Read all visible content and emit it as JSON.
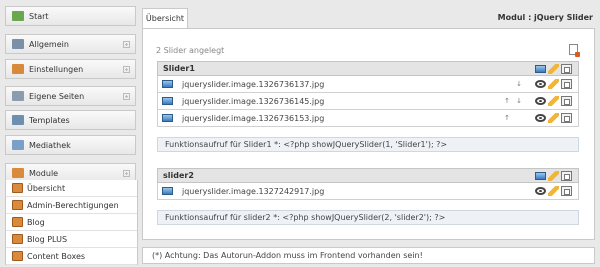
{
  "sidebar": {
    "items": [
      {
        "label": "Start",
        "icon": "home-icon",
        "color": "#6aa84f"
      },
      {
        "label": "Allgemein",
        "icon": "list-icon",
        "color": "#7b8fa6"
      },
      {
        "label": "Einstellungen",
        "icon": "settings-icon",
        "color": "#d88a3c"
      },
      {
        "label": "Eigene Seiten",
        "icon": "pages-icon",
        "color": "#8b9cae"
      },
      {
        "label": "Templates",
        "icon": "template-icon",
        "color": "#6f8fb0"
      },
      {
        "label": "Mediathek",
        "icon": "media-icon",
        "color": "#7aa0c8"
      },
      {
        "label": "Module",
        "icon": "module-icon",
        "color": "#d98a3c"
      }
    ],
    "sub_items": [
      {
        "label": "Übersicht"
      },
      {
        "label": "Admin-Berechtigungen"
      },
      {
        "label": "Blog"
      },
      {
        "label": "Blog PLUS"
      },
      {
        "label": "Content Boxes"
      }
    ]
  },
  "main": {
    "tab_label": "Übersicht",
    "module_title": "Modul : jQuery Slider",
    "slider_count_text": "2 Slider angelegt",
    "sliders": [
      {
        "title": "Slider1",
        "images": [
          {
            "filename": "jqueryslider.image.1326736137.jpg",
            "up": "",
            "down": "↓"
          },
          {
            "filename": "jqueryslider.image.1326736145.jpg",
            "up": "↑",
            "down": "↓"
          },
          {
            "filename": "jqueryslider.image.1326736153.jpg",
            "up": "↑",
            "down": ""
          }
        ],
        "function_call": "Funktionsaufruf für Slider1 *: <?php showJQuerySlider(1, 'Slider1'); ?>"
      },
      {
        "title": "slider2",
        "images": [
          {
            "filename": "jqueryslider.image.1327242917.jpg",
            "up": "",
            "down": ""
          }
        ],
        "function_call": "Funktionsaufruf für slider2 *: <?php showJQuerySlider(2, 'slider2'); ?>"
      }
    ],
    "footer_note": "(*) Achtung: Das Autorun-Addon muss im Frontend vorhanden sein!"
  }
}
